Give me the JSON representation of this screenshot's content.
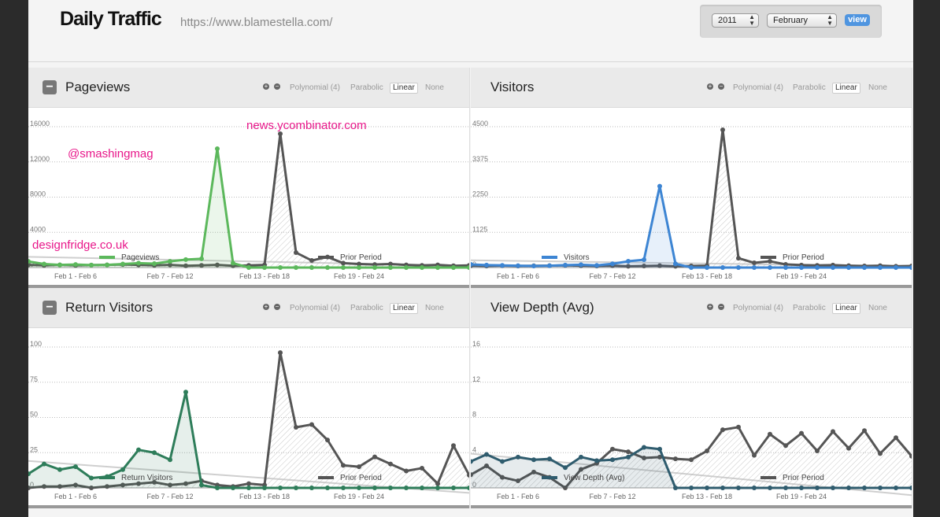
{
  "header": {
    "title": "Daily Traffic",
    "url": "https://www.blamestella.com/",
    "year": "2011",
    "month": "February",
    "view_label": "view"
  },
  "fit_options": [
    "Polynomial (4)",
    "Parabolic",
    "Linear",
    "None"
  ],
  "active_fit": "Linear",
  "zoom": {
    "plus": "+",
    "minus": "−"
  },
  "collapse_label": "−",
  "x_ticks": [
    "Feb 1 - Feb 6",
    "Feb 7 - Feb 12",
    "Feb 13 - Feb 18",
    "Feb 19 - Feb 24"
  ],
  "colors": {
    "pageviews": "#5cb85c",
    "visitors": "#3d85d3",
    "return_visitors": "#2e7d5a",
    "view_depth": "#2f5c6e",
    "prior": "#555555",
    "annotation": "#e8178a"
  },
  "annotations": [
    "news.ycombinator.com",
    "@smashingmag",
    "designfridge.co.uk"
  ],
  "chart_data": [
    {
      "type": "line",
      "title": "Pageviews",
      "yticks": [
        "16000",
        "12000",
        "8000",
        "4000",
        "0"
      ],
      "ylim": [
        0,
        16000
      ],
      "series": [
        {
          "name": "Pageviews",
          "values": [
            700,
            400,
            300,
            350,
            280,
            300,
            400,
            500,
            450,
            700,
            900,
            1000,
            13500,
            500,
            0,
            0,
            0,
            0,
            0,
            0,
            0,
            0,
            0,
            0,
            0,
            0,
            0,
            0,
            0
          ]
        },
        {
          "name": "Prior Period",
          "values": [
            300,
            250,
            300,
            250,
            280,
            300,
            350,
            300,
            250,
            300,
            200,
            250,
            300,
            200,
            250,
            300,
            15200,
            1700,
            800,
            1200,
            500,
            400,
            350,
            400,
            300,
            250,
            300,
            200,
            250
          ]
        }
      ]
    },
    {
      "type": "line",
      "title": "Visitors",
      "yticks": [
        "4500",
        "3375",
        "2250",
        "1125",
        "0"
      ],
      "ylim": [
        0,
        4500
      ],
      "series": [
        {
          "name": "Visitors",
          "values": [
            100,
            80,
            70,
            60,
            50,
            60,
            80,
            90,
            70,
            120,
            200,
            250,
            2600,
            120,
            0,
            0,
            0,
            0,
            0,
            0,
            0,
            0,
            0,
            0,
            0,
            0,
            0,
            0,
            0
          ]
        },
        {
          "name": "Prior Period",
          "values": [
            60,
            50,
            60,
            50,
            55,
            60,
            70,
            60,
            50,
            60,
            40,
            50,
            60,
            40,
            50,
            60,
            4400,
            300,
            150,
            200,
            100,
            80,
            70,
            80,
            60,
            50,
            60,
            40,
            50
          ]
        }
      ]
    },
    {
      "type": "line",
      "title": "Return Visitors",
      "yticks": [
        "100",
        "75",
        "50",
        "25",
        "0"
      ],
      "ylim": [
        0,
        100
      ],
      "series": [
        {
          "name": "Return Visitors",
          "values": [
            10,
            17,
            13,
            15,
            7,
            8,
            13,
            27,
            25,
            20,
            68,
            2,
            0,
            0,
            0,
            0,
            0,
            0,
            0,
            0,
            0,
            0,
            0,
            0,
            0,
            0,
            0,
            0,
            0
          ]
        },
        {
          "name": "Prior Period",
          "values": [
            0,
            1,
            1,
            2,
            0,
            1,
            2,
            3,
            4,
            2,
            3,
            5,
            2,
            1,
            3,
            2,
            96,
            43,
            45,
            34,
            16,
            15,
            22,
            17,
            12,
            14,
            3,
            30,
            9
          ]
        }
      ]
    },
    {
      "type": "line",
      "title": "View Depth (Avg)",
      "yticks": [
        "16",
        "12",
        "8",
        "4",
        "0"
      ],
      "ylim": [
        0,
        16
      ],
      "series": [
        {
          "name": "View Depth (Avg)",
          "values": [
            3,
            3.8,
            3,
            3.5,
            3.2,
            3.3,
            2.3,
            3.5,
            3.1,
            3.2,
            3.5,
            4.6,
            4.4,
            0,
            0,
            0,
            0,
            0,
            0,
            0,
            0,
            0,
            0,
            0,
            0,
            0,
            0,
            0,
            0
          ]
        },
        {
          "name": "Prior Period",
          "values": [
            1.5,
            2.5,
            1.2,
            0.8,
            1.8,
            1.2,
            0,
            2.1,
            2.8,
            4.4,
            4.1,
            3.4,
            3.5,
            3.3,
            3.2,
            4.2,
            6.6,
            6.9,
            3.7,
            6.1,
            4.8,
            6.2,
            4.2,
            6.4,
            4.5,
            6.5,
            3.9,
            5.7,
            3.6
          ]
        }
      ]
    }
  ]
}
